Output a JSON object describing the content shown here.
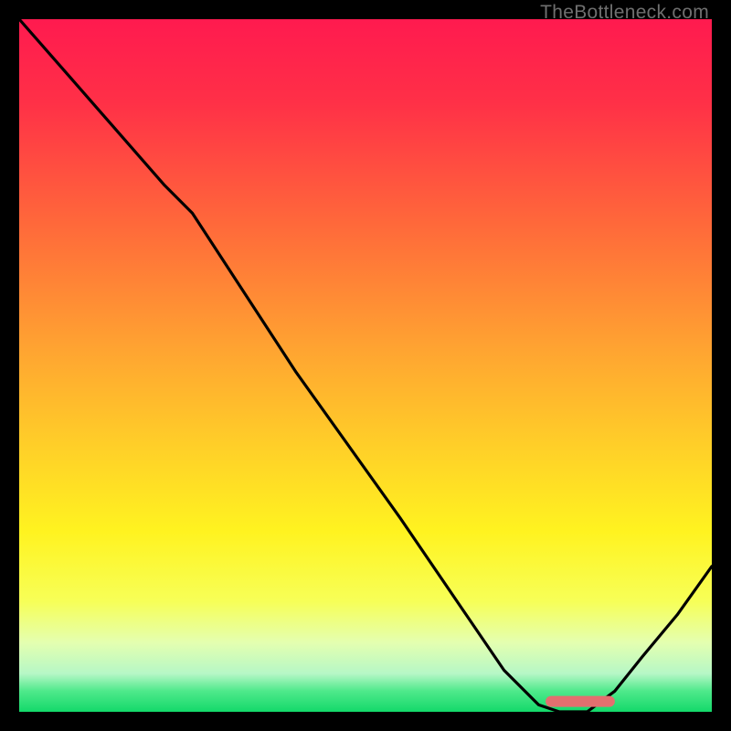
{
  "watermark": "TheBottleneck.com",
  "chart_data": {
    "type": "line",
    "title": "",
    "xlabel": "",
    "ylabel": "",
    "xlim": [
      0,
      100
    ],
    "ylim": [
      0,
      100
    ],
    "grid": false,
    "legend": false,
    "series": [
      {
        "name": "bottleneck-curve",
        "x": [
          0,
          7,
          21,
          25,
          40,
          55,
          70,
          75,
          78,
          82,
          86,
          90,
          95,
          100
        ],
        "values": [
          100,
          92,
          76,
          72,
          49,
          28,
          6,
          1,
          0,
          0,
          3,
          8,
          14,
          21
        ]
      }
    ],
    "marker": {
      "name": "optimal-range",
      "x_start": 76,
      "x_end": 86,
      "y": 1.5,
      "color": "#e36f6f"
    },
    "gradient_stops": [
      {
        "offset": 0.0,
        "color": "#ff1a4f"
      },
      {
        "offset": 0.12,
        "color": "#ff3047"
      },
      {
        "offset": 0.3,
        "color": "#ff6a3a"
      },
      {
        "offset": 0.48,
        "color": "#ffa531"
      },
      {
        "offset": 0.62,
        "color": "#ffd028"
      },
      {
        "offset": 0.74,
        "color": "#fff320"
      },
      {
        "offset": 0.84,
        "color": "#f7ff57"
      },
      {
        "offset": 0.9,
        "color": "#e4ffb0"
      },
      {
        "offset": 0.945,
        "color": "#b6f7c6"
      },
      {
        "offset": 0.97,
        "color": "#4fe98b"
      },
      {
        "offset": 1.0,
        "color": "#13d96a"
      }
    ]
  }
}
